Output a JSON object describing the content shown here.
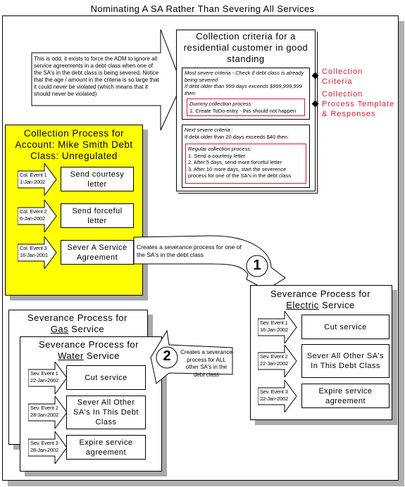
{
  "title": "Nominating A SA Rather Than Severing All Services",
  "comment": "This is odd, it exists to force the ADM to ignore all service agreements in a debt class when one of the SA's in the debt class is being severed. Notice that the age / amount in the criteria is so large that it could never be violated (which means that it should never be violated)",
  "criteria": {
    "title": "Collection criteria  for a residential customer in good standing",
    "c1_head": "Most severe criteria - Check if debt class is already being severed",
    "c1_cond": "If debt older than 999 days exceeds $999,999,999 then:",
    "c1_proc_title": "Dummy collection process:",
    "c1_proc_items": [
      "1.    Create ToDo entry - this should not happen"
    ],
    "c2_head": "Next severe criteria :",
    "c2_cond": "If debt older than 20 days exceeds $40 then:",
    "c2_proc_title": "Regular collection process:",
    "c2_proc_items": [
      "1.    Send a courtesy letter",
      "2.    After 5 days, send more forceful letter",
      "3.    After 10 more days, start the severence process for one of the SA's in the debt class"
    ]
  },
  "labels": {
    "criteria": "Collection Criteria",
    "template": "Collection Process Template & Responses"
  },
  "colors": {
    "accent_red": "#e8142c",
    "process_fill": "#ffff00",
    "shadow": "#a8a8a8"
  },
  "collection": {
    "title": "Collection Process for Account: Mike Smith Debt Class: Unregulated",
    "events": [
      {
        "label": "Col. Event 1\n1-Jan-2002",
        "action": "Send courtesy letter"
      },
      {
        "label": "Col. Event 2\n6-Jan-2002",
        "action": "Send forceful letter"
      },
      {
        "label": "Col. Event 3\n16-Jan-2001",
        "action": "Sever A Service Agreement"
      }
    ]
  },
  "callout1": {
    "text": "Creates a severance process for one of the SA's in the debt class",
    "num": "1"
  },
  "callout2": {
    "text": "Creates a severance process for ALL other SA's in the debt class",
    "num": "2"
  },
  "electric": {
    "title_pre": "Severance Process for",
    "service": "Electric",
    "title_post": "Service",
    "events": [
      {
        "label": "Sev. Event 1\n16-Jan-2002",
        "action": "Cut service"
      },
      {
        "label": "Sev. Event 2\n22-Jan-2002",
        "action": "Sever All Other SA's In This Debt Class"
      },
      {
        "label": "Sev. Event 3\n22-Jan-2002",
        "action": "Expire service agreement"
      }
    ]
  },
  "gas": {
    "title_pre": "Severance Process for",
    "service": "Gas",
    "title_post": "Service"
  },
  "water": {
    "title_pre": "Severance Process for",
    "service": "Water",
    "title_post": "Service",
    "events": [
      {
        "label": "Sev. Event 1\n22-Jan-2002",
        "action": "Cut service"
      },
      {
        "label": "Sev. Event 2\n28-Jan-2002",
        "action": "Sever All Other SA's In This Debt Class"
      },
      {
        "label": "Sev. Event 3\n28-Jan-2002",
        "action": "Expire service agreement"
      }
    ]
  }
}
